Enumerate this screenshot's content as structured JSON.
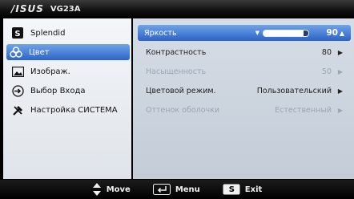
{
  "header": {
    "brand": "/ISUS",
    "model": "VG23A"
  },
  "sidebar": {
    "items": [
      {
        "label": "Splendid",
        "icon": "splendid-s-icon"
      },
      {
        "label": "Цвет",
        "icon": "color-palette-icon"
      },
      {
        "label": "Изображ.",
        "icon": "image-icon"
      },
      {
        "label": "Выбор Входа",
        "icon": "input-select-icon"
      },
      {
        "label": "Настройка СИСТЕМА",
        "icon": "system-setup-icon"
      }
    ],
    "selected_index": 1
  },
  "settings": [
    {
      "label": "Яркость",
      "value": "90",
      "slider_percent": 90
    },
    {
      "label": "Контрастность",
      "value": "80"
    },
    {
      "label": "Насыщенность",
      "value": "50"
    },
    {
      "label": "Цветовой режим.",
      "value": "Пользовательский"
    },
    {
      "label": "Оттенок оболочки",
      "value": "Естественный"
    }
  ],
  "footer": {
    "move": "Move",
    "menu": "Menu",
    "exit": "Exit",
    "exit_key": "S"
  },
  "colors": {
    "highlight": "#3d74d6",
    "panel": "#c9d1dc",
    "disabled_text": "#9aa6b4"
  }
}
